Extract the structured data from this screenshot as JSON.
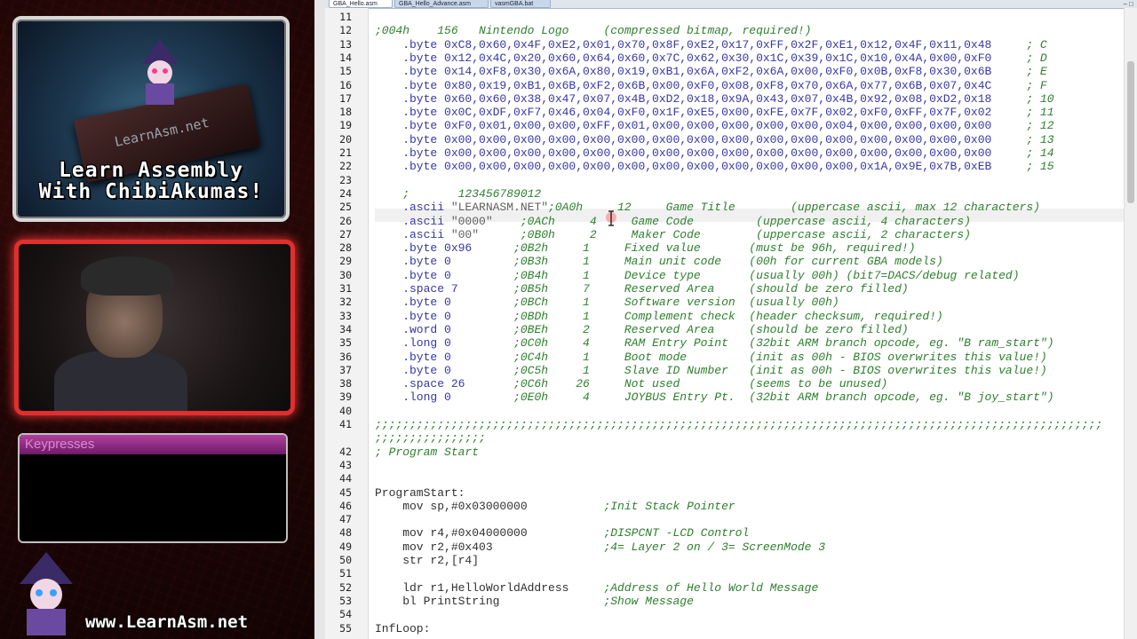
{
  "overlay": {
    "logo_text": "LearnAsm.net",
    "tagline_line1": "Learn Assembly",
    "tagline_line2": "With ChibiAkumas!",
    "keypresses_title": "Keypresses",
    "bottom_banner": "www.LearnAsm.net",
    "accent_red": "#e22e2e",
    "keypress_purple": "#b0409c"
  },
  "editor": {
    "tabs": [
      {
        "label": "GBA_Hello.asm",
        "active": true
      },
      {
        "label": "GBA_Hello_Advance.asm",
        "active": false
      },
      {
        "label": "vasmGBA.bat",
        "active": false
      }
    ],
    "window_controls": "– □",
    "lines": [
      {
        "n": "11",
        "segs": [
          {
            "t": "",
            "c": "c-blue"
          }
        ]
      },
      {
        "n": "12",
        "segs": [
          {
            "t": ";004h    156   Nintendo Logo     (compressed bitmap, required!)",
            "c": "c-green"
          }
        ]
      },
      {
        "n": "13",
        "segs": [
          {
            "t": "    .byte 0xC8,0x60,0x4F,0xE2,0x01,0x70,0x8F,0xE2,0x17,0xFF,0x2F,0xE1,0x12,0x4F,0x11,0x48",
            "c": "c-blue"
          },
          {
            "t": "     ; C",
            "c": "c-green"
          }
        ]
      },
      {
        "n": "14",
        "segs": [
          {
            "t": "    .byte 0x12,0x4C,0x20,0x60,0x64,0x60,0x7C,0x62,0x30,0x1C,0x39,0x1C,0x10,0x4A,0x00,0xF0",
            "c": "c-blue"
          },
          {
            "t": "     ; D",
            "c": "c-green"
          }
        ]
      },
      {
        "n": "15",
        "segs": [
          {
            "t": "    .byte 0x14,0xF8,0x30,0x6A,0x80,0x19,0xB1,0x6A,0xF2,0x6A,0x00,0xF0,0x0B,0xF8,0x30,0x6B",
            "c": "c-blue"
          },
          {
            "t": "     ; E",
            "c": "c-green"
          }
        ]
      },
      {
        "n": "16",
        "segs": [
          {
            "t": "    .byte 0x80,0x19,0xB1,0x6B,0xF2,0x6B,0x00,0xF0,0x08,0xF8,0x70,0x6A,0x77,0x6B,0x07,0x4C",
            "c": "c-blue"
          },
          {
            "t": "     ; F",
            "c": "c-green"
          }
        ]
      },
      {
        "n": "17",
        "segs": [
          {
            "t": "    .byte 0x60,0x60,0x38,0x47,0x07,0x4B,0xD2,0x18,0x9A,0x43,0x07,0x4B,0x92,0x08,0xD2,0x18",
            "c": "c-blue"
          },
          {
            "t": "     ; 10",
            "c": "c-green"
          }
        ]
      },
      {
        "n": "18",
        "segs": [
          {
            "t": "    .byte 0x0C,0xDF,0xF7,0x46,0x04,0xF0,0x1F,0xE5,0x00,0xFE,0x7F,0x02,0xF0,0xFF,0x7F,0x02",
            "c": "c-blue"
          },
          {
            "t": "     ; 11",
            "c": "c-green"
          }
        ]
      },
      {
        "n": "19",
        "segs": [
          {
            "t": "    .byte 0xF0,0x01,0x00,0x00,0xFF,0x01,0x00,0x00,0x00,0x00,0x00,0x04,0x00,0x00,0x00,0x00",
            "c": "c-blue"
          },
          {
            "t": "     ; 12",
            "c": "c-green"
          }
        ]
      },
      {
        "n": "20",
        "segs": [
          {
            "t": "    .byte 0x00,0x00,0x00,0x00,0x00,0x00,0x00,0x00,0x00,0x00,0x00,0x00,0x00,0x00,0x00,0x00",
            "c": "c-blue"
          },
          {
            "t": "     ; 13",
            "c": "c-green"
          }
        ]
      },
      {
        "n": "21",
        "segs": [
          {
            "t": "    .byte 0x00,0x00,0x00,0x00,0x00,0x00,0x00,0x00,0x00,0x00,0x00,0x00,0x00,0x00,0x00,0x00",
            "c": "c-blue"
          },
          {
            "t": "     ; 14",
            "c": "c-green"
          }
        ]
      },
      {
        "n": "22",
        "segs": [
          {
            "t": "    .byte 0x00,0x00,0x00,0x00,0x00,0x00,0x00,0x00,0x00,0x00,0x00,0x00,0x1A,0x9E,0x7B,0xEB",
            "c": "c-blue"
          },
          {
            "t": "     ; 15",
            "c": "c-green"
          }
        ]
      },
      {
        "n": "23",
        "segs": [
          {
            "t": "",
            "c": "c-blue"
          }
        ]
      },
      {
        "n": "24",
        "segs": [
          {
            "t": "    ;       123456789012",
            "c": "c-green"
          }
        ]
      },
      {
        "n": "25",
        "segs": [
          {
            "t": "    .ascii ",
            "c": "c-blue"
          },
          {
            "t": "\"LEARNASM.NET\"",
            "c": "c-grey"
          },
          {
            "t": ";0A0h     12     Game Title        (uppercase ascii, max 12 characters)",
            "c": "c-green"
          }
        ]
      },
      {
        "n": "26",
        "segs": [
          {
            "t": "    .ascii ",
            "c": "c-blue"
          },
          {
            "t": "\"0000\"",
            "c": "c-grey"
          },
          {
            "t": "    ;0ACh     4     Game Code         (uppercase ascii, 4 characters)",
            "c": "c-green"
          }
        ]
      },
      {
        "n": "27",
        "segs": [
          {
            "t": "    .ascii ",
            "c": "c-blue"
          },
          {
            "t": "\"00\"",
            "c": "c-grey"
          },
          {
            "t": "      ;0B0h     2     Maker Code        (uppercase ascii, 2 characters)",
            "c": "c-green"
          }
        ]
      },
      {
        "n": "28",
        "segs": [
          {
            "t": "    .byte 0x96",
            "c": "c-blue"
          },
          {
            "t": "      ;0B2h     1     Fixed value       (must be 96h, required!)",
            "c": "c-green"
          }
        ]
      },
      {
        "n": "29",
        "segs": [
          {
            "t": "    .byte 0",
            "c": "c-blue"
          },
          {
            "t": "         ;0B3h     1     Main unit code    (00h for current GBA models)",
            "c": "c-green"
          }
        ]
      },
      {
        "n": "30",
        "segs": [
          {
            "t": "    .byte 0",
            "c": "c-blue"
          },
          {
            "t": "         ;0B4h     1     Device type       (usually 00h) (bit7=DACS/debug related)",
            "c": "c-green"
          }
        ]
      },
      {
        "n": "31",
        "segs": [
          {
            "t": "    .space 7",
            "c": "c-blue"
          },
          {
            "t": "        ;0B5h     7     Reserved Area     (should be zero filled)",
            "c": "c-green"
          }
        ]
      },
      {
        "n": "32",
        "segs": [
          {
            "t": "    .byte 0",
            "c": "c-blue"
          },
          {
            "t": "         ;0BCh     1     Software version  (usually 00h)",
            "c": "c-green"
          }
        ]
      },
      {
        "n": "33",
        "segs": [
          {
            "t": "    .byte 0",
            "c": "c-blue"
          },
          {
            "t": "         ;0BDh     1     Complement check  (header checksum, required!)",
            "c": "c-green"
          }
        ]
      },
      {
        "n": "34",
        "segs": [
          {
            "t": "    .word 0",
            "c": "c-blue"
          },
          {
            "t": "         ;0BEh     2     Reserved Area     (should be zero filled)",
            "c": "c-green"
          }
        ]
      },
      {
        "n": "35",
        "segs": [
          {
            "t": "    .long 0",
            "c": "c-blue"
          },
          {
            "t": "         ;0C0h     4     RAM Entry Point   (32bit ARM branch opcode, eg. \"B ram_start\")",
            "c": "c-green"
          }
        ]
      },
      {
        "n": "36",
        "segs": [
          {
            "t": "    .byte 0",
            "c": "c-blue"
          },
          {
            "t": "         ;0C4h     1     Boot mode         (init as 00h - BIOS overwrites this value!)",
            "c": "c-green"
          }
        ]
      },
      {
        "n": "37",
        "segs": [
          {
            "t": "    .byte 0",
            "c": "c-blue"
          },
          {
            "t": "         ;0C5h     1     Slave ID Number   (init as 00h - BIOS overwrites this value!)",
            "c": "c-green"
          }
        ]
      },
      {
        "n": "38",
        "segs": [
          {
            "t": "    .space 26",
            "c": "c-blue"
          },
          {
            "t": "       ;0C6h    26     Not used          (seems to be unused)",
            "c": "c-green"
          }
        ]
      },
      {
        "n": "39",
        "segs": [
          {
            "t": "    .long 0",
            "c": "c-blue"
          },
          {
            "t": "         ;0E0h     4     JOYBUS Entry Pt.  (32bit ARM branch opcode, eg. \"B joy_start\")",
            "c": "c-green"
          }
        ]
      },
      {
        "n": "40",
        "segs": [
          {
            "t": "",
            "c": "c-blue"
          }
        ]
      },
      {
        "n": "41",
        "segs": [
          {
            "t": ";;;;;;;;;;;;;;;;;;;;;;;;;;;;;;;;;;;;;;;;;;;;;;;;;;;;;;;;;;;;;;;;;;;;;;;;;;;;;;;;;;;;;;;;;;;;;;;;;;;;;;;;;",
            "c": "c-green"
          }
        ]
      },
      {
        "n": "",
        "segs": [
          {
            "t": ";;;;;;;;;;;;;;;;",
            "c": "c-green"
          }
        ]
      },
      {
        "n": "42",
        "segs": [
          {
            "t": "; Program Start",
            "c": "c-green"
          }
        ]
      },
      {
        "n": "43",
        "segs": [
          {
            "t": "",
            "c": "c-blue"
          }
        ]
      },
      {
        "n": "44",
        "segs": [
          {
            "t": "",
            "c": "c-blue"
          }
        ]
      },
      {
        "n": "45",
        "segs": [
          {
            "t": "ProgramStart:",
            "c": "c-dark"
          }
        ]
      },
      {
        "n": "46",
        "segs": [
          {
            "t": "    mov sp,#0x03000000",
            "c": "c-dark"
          },
          {
            "t": "           ;Init Stack Pointer",
            "c": "c-green"
          }
        ]
      },
      {
        "n": "47",
        "segs": [
          {
            "t": "",
            "c": "c-blue"
          }
        ]
      },
      {
        "n": "48",
        "segs": [
          {
            "t": "    mov r4,#0x04000000",
            "c": "c-dark"
          },
          {
            "t": "           ;DISPCNT -LCD Control",
            "c": "c-green"
          }
        ]
      },
      {
        "n": "49",
        "segs": [
          {
            "t": "    mov r2,#0x403",
            "c": "c-dark"
          },
          {
            "t": "                ;4= Layer 2 on / 3= ScreenMode 3",
            "c": "c-green"
          }
        ]
      },
      {
        "n": "50",
        "segs": [
          {
            "t": "    str r2,[r4]",
            "c": "c-dark"
          }
        ]
      },
      {
        "n": "51",
        "segs": [
          {
            "t": "",
            "c": "c-blue"
          }
        ]
      },
      {
        "n": "52",
        "segs": [
          {
            "t": "    ldr r1,HelloWorldAddress",
            "c": "c-dark"
          },
          {
            "t": "     ;Address of Hello World Message",
            "c": "c-green"
          }
        ]
      },
      {
        "n": "53",
        "segs": [
          {
            "t": "    bl PrintString",
            "c": "c-dark"
          },
          {
            "t": "               ;Show Message",
            "c": "c-green"
          }
        ]
      },
      {
        "n": "54",
        "segs": [
          {
            "t": "",
            "c": "c-blue"
          }
        ]
      },
      {
        "n": "55",
        "segs": [
          {
            "t": "InfLoop:",
            "c": "c-dark"
          }
        ]
      }
    ]
  }
}
